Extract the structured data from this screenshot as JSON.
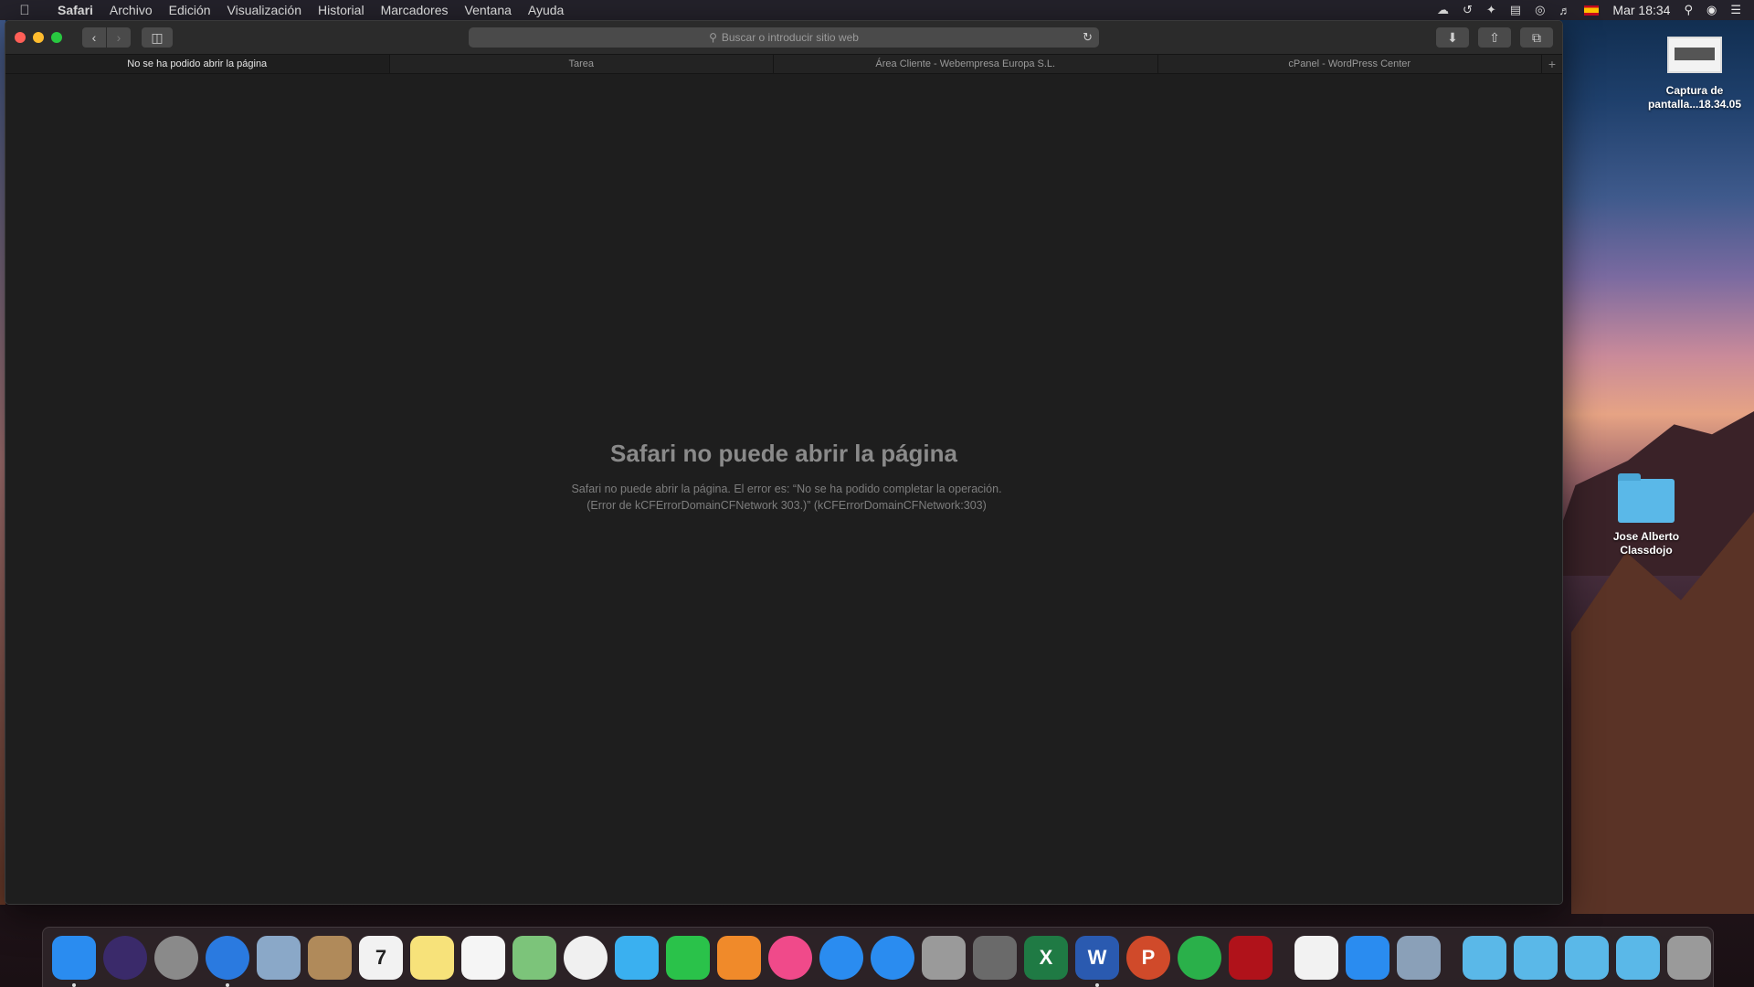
{
  "menubar": {
    "app_name": "Safari",
    "items": [
      "Archivo",
      "Edición",
      "Visualización",
      "Historial",
      "Marcadores",
      "Ventana",
      "Ayuda"
    ],
    "clock": "Mar 18:34"
  },
  "toolbar": {
    "address_placeholder": "Buscar o introducir sitio web"
  },
  "tabs": [
    {
      "label": "No se ha podido abrir la página",
      "active": true
    },
    {
      "label": "Tarea",
      "active": false
    },
    {
      "label": "Área Cliente - Webempresa Europa S.L.",
      "active": false
    },
    {
      "label": "cPanel - WordPress Center",
      "active": false
    }
  ],
  "error": {
    "title": "Safari no puede abrir la página",
    "message_line1": "Safari no puede abrir la página. El error es: “No se ha podido completar la operación.",
    "message_line2": "(Error de kCFErrorDomainCFNetwork 303.)” (kCFErrorDomainCFNetwork:303)"
  },
  "desktop": {
    "file_line1": "Captura de",
    "file_line2": "pantalla...18.34.05",
    "folder_line1": "Jose Alberto",
    "folder_line2": "Classdojo"
  },
  "dock": {
    "apps": [
      {
        "name": "finder",
        "color": "#2a8cf0"
      },
      {
        "name": "siri",
        "color": "#3a2a6a"
      },
      {
        "name": "launchpad",
        "color": "#8a8a8a"
      },
      {
        "name": "safari",
        "color": "#2a7ae0"
      },
      {
        "name": "mail",
        "color": "#8aa8c8"
      },
      {
        "name": "contacts",
        "color": "#b08a5a"
      },
      {
        "name": "calendar",
        "color": "#f2f2f2"
      },
      {
        "name": "notes",
        "color": "#f7e27a"
      },
      {
        "name": "reminders",
        "color": "#f5f5f5"
      },
      {
        "name": "maps",
        "color": "#7cc47a"
      },
      {
        "name": "photos",
        "color": "#f0f0f0"
      },
      {
        "name": "messages",
        "color": "#3ab0f0"
      },
      {
        "name": "facetime",
        "color": "#2ac24a"
      },
      {
        "name": "pages",
        "color": "#f08a2a"
      },
      {
        "name": "itunes",
        "color": "#f04a8a"
      },
      {
        "name": "app-store",
        "color": "#2a8cf0"
      },
      {
        "name": "xcode",
        "color": "#2a8cf0"
      },
      {
        "name": "disk-utility",
        "color": "#9a9a9a"
      },
      {
        "name": "system-preferences",
        "color": "#6a6a6a"
      },
      {
        "name": "excel",
        "color": "#1f7a44"
      },
      {
        "name": "word",
        "color": "#2a5ab0"
      },
      {
        "name": "powerpoint",
        "color": "#d04a2a"
      },
      {
        "name": "evernote",
        "color": "#2ab04a"
      },
      {
        "name": "acrobat",
        "color": "#b0121a"
      }
    ],
    "extras": [
      {
        "name": "textedit",
        "color": "#f2f2f2"
      },
      {
        "name": "zoom",
        "color": "#2a8cf0"
      },
      {
        "name": "preview",
        "color": "#8aa0b8"
      }
    ],
    "folders": [
      {
        "name": "downloads-folder",
        "color": "#5ab8e8"
      },
      {
        "name": "applications-folder",
        "color": "#5ab8e8"
      },
      {
        "name": "screenshots-folder",
        "color": "#5ab8e8"
      },
      {
        "name": "documents-folder",
        "color": "#5ab8e8"
      },
      {
        "name": "trash",
        "color": "#9a9a9a"
      }
    ],
    "glyphs": {
      "excel": "X",
      "word": "W",
      "powerpoint": "P",
      "calendar": "7"
    }
  }
}
